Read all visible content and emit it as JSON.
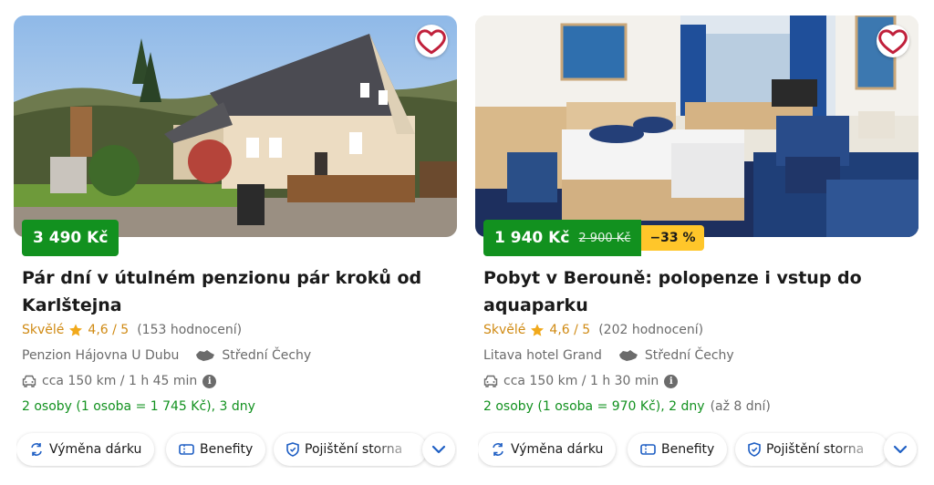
{
  "cards": [
    {
      "price": "3 490 Kč",
      "old_price": "",
      "discount": "",
      "title": "Pár dní v útulném penzionu pár kroků od Karlštejna",
      "rating_word": "Skvělé",
      "rating_score": "4,6 / 5",
      "rating_count": "(153 hodnocení)",
      "hotel": "Penzion Hájovna U Dubu",
      "region": "Střední Čechy",
      "drive": "cca 150 km / 1 h 45 min",
      "persons": "2 osoby (1 osoba = 1 745 Kč), 3 dny",
      "persons_extra": "",
      "chips": [
        "Výměna dárku",
        "Benefity",
        "Pojištění storna"
      ],
      "image": "cottage-photo"
    },
    {
      "price": "1 940 Kč",
      "old_price": "2 900 Kč",
      "discount": "−33 %",
      "title": "Pobyt v Berouně: polopenze i vstup do aquaparku",
      "rating_word": "Skvělé",
      "rating_score": "4,6 / 5",
      "rating_count": "(202 hodnocení)",
      "hotel": "Litava hotel Grand",
      "region": "Střední Čechy",
      "drive": "cca 150 km / 1 h 30 min",
      "persons": "2 osoby (1 osoba = 970 Kč), 2 dny",
      "persons_extra": "(až 8 dní)",
      "chips": [
        "Výměna dárku",
        "Benefity",
        "Pojištění storna"
      ],
      "image": "hotel-room-photo"
    }
  ],
  "icons": {
    "favorite": "heart-outline-icon",
    "star": "star-icon",
    "region": "czech-map-icon",
    "car": "car-icon",
    "info": "info-icon",
    "exchange": "exchange-icon",
    "benefits": "ticket-icon",
    "insurance": "shield-icon",
    "expand": "chevron-down-icon"
  },
  "colors": {
    "price_bg": "#12911f",
    "discount_bg": "#ffc62a",
    "rating": "#d08a13",
    "persons": "#12911f",
    "accent": "#1f5fc4"
  }
}
